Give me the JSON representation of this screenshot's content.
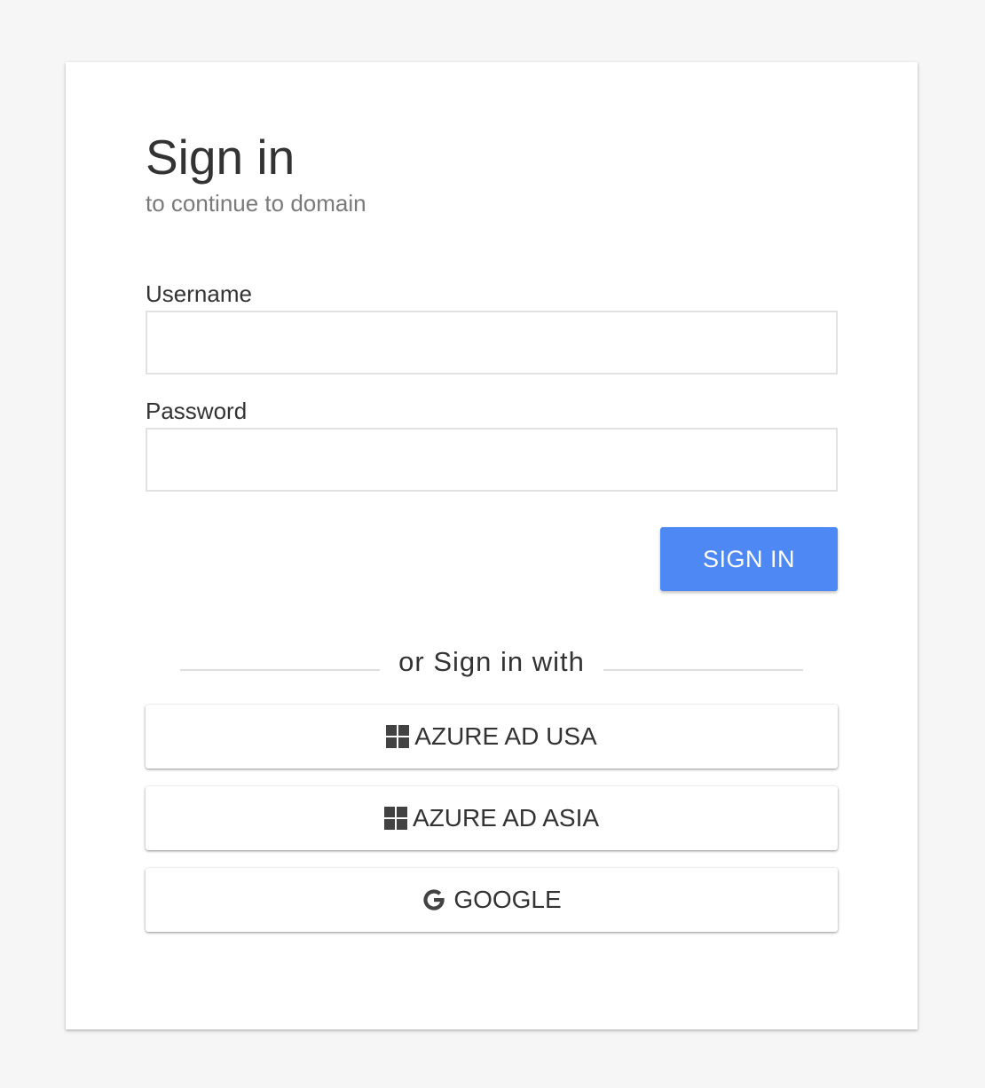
{
  "header": {
    "title": "Sign in",
    "subtitle": "to continue to domain"
  },
  "form": {
    "username_label": "Username",
    "username_value": "",
    "password_label": "Password",
    "password_value": "",
    "submit_label": "SIGN IN"
  },
  "divider": {
    "text": "or Sign in with"
  },
  "providers": [
    {
      "label": "AZURE AD USA",
      "icon": "windows-icon"
    },
    {
      "label": "AZURE AD ASIA",
      "icon": "windows-icon"
    },
    {
      "label": "GOOGLE",
      "icon": "google-icon"
    }
  ],
  "colors": {
    "background": "#f6f6f6",
    "card": "#ffffff",
    "primary": "#4e88f5",
    "text": "#333333",
    "muted_text": "#7a7a7a"
  }
}
